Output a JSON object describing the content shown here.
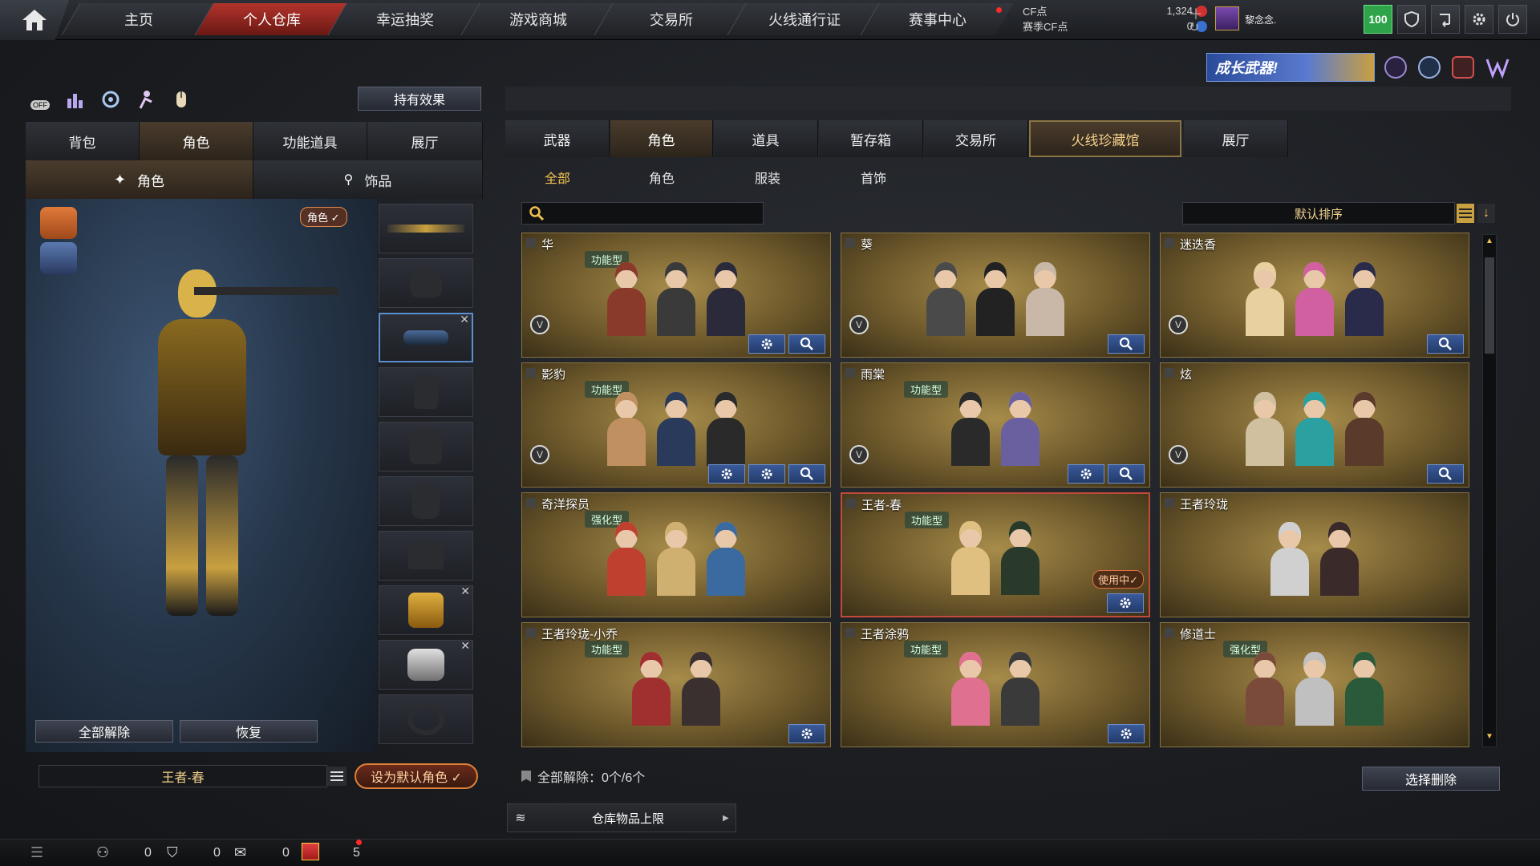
{
  "nav": {
    "tabs": [
      "主页",
      "个人仓库",
      "幸运抽奖",
      "游戏商城",
      "交易所",
      "火线通行证",
      "赛事中心"
    ],
    "active_tab": "个人仓库"
  },
  "currency": {
    "cf_label": "CF点",
    "cf_value": "1,324",
    "season_label": "赛季CF点",
    "season_value": "0"
  },
  "user": {
    "name": "黎念念.",
    "level": "100"
  },
  "banner": {
    "text": "成长武器!"
  },
  "left": {
    "effect_button": "持有效果",
    "tabs": [
      "背包",
      "角色",
      "功能道具",
      "展厅"
    ],
    "active_tab": "角色",
    "subtabs": [
      "角色",
      "饰品"
    ],
    "badge": "角色 ✓",
    "release_all": "全部解除",
    "restore": "恢复",
    "current_role": "王者-春",
    "set_default": "设为默认角色 ✓"
  },
  "right": {
    "tabs": [
      "武器",
      "角色",
      "道具",
      "暂存箱",
      "交易所",
      "火线珍藏馆",
      "展厅"
    ],
    "active_tabs": [
      "角色",
      "火线珍藏馆"
    ],
    "subtabs": [
      "全部",
      "角色",
      "服装",
      "首饰"
    ],
    "active_subtab": "全部",
    "search_placeholder": "",
    "sort_label": "默认排序",
    "footer_release": "全部解除：0个/6个",
    "select_delete": "选择删除",
    "storage_limit": "仓库物品上限"
  },
  "cards": [
    {
      "name": "华",
      "badge": "功能型",
      "v": true,
      "buttons": [
        "gear",
        "search"
      ],
      "colors": [
        "#8a3a2a",
        "#3a3a3a",
        "#2a2a3a"
      ]
    },
    {
      "name": "葵",
      "badge": "",
      "v": true,
      "buttons": [
        "search"
      ],
      "colors": [
        "#4a4a4a",
        "#222",
        "#c9b8a8"
      ]
    },
    {
      "name": "迷迭香",
      "badge": "",
      "v": true,
      "buttons": [
        "search"
      ],
      "colors": [
        "#e8d0a0",
        "#d060a0",
        "#2a2a4a"
      ]
    },
    {
      "name": "影豹",
      "badge": "功能型",
      "v": true,
      "buttons": [
        "gear-w",
        "gear",
        "search"
      ],
      "colors": [
        "#c09060",
        "#2a3a5a",
        "#2a2a2a"
      ]
    },
    {
      "name": "雨棠",
      "badge": "功能型",
      "v": true,
      "buttons": [
        "gear-w",
        "search"
      ],
      "colors": [
        "#2a2a2a",
        "#6a60a0"
      ]
    },
    {
      "name": "炫",
      "badge": "",
      "v": true,
      "buttons": [
        "search"
      ],
      "colors": [
        "#d0c0a0",
        "#2aa0a0",
        "#5a3a2a"
      ]
    },
    {
      "name": "奇洋探员",
      "badge": "强化型",
      "v": false,
      "buttons": [],
      "colors": [
        "#c04030",
        "#d0b070",
        "#3a6aa0"
      ]
    },
    {
      "name": "王者-春",
      "badge": "功能型",
      "v": false,
      "buttons": [
        "gear"
      ],
      "colors": [
        "#e0c080",
        "#2a3a2a"
      ],
      "in_use": "使用中✓"
    },
    {
      "name": "王者玲珑",
      "badge": "",
      "v": false,
      "buttons": [],
      "colors": [
        "#d0d0d0",
        "#3a2a2a"
      ]
    },
    {
      "name": "王者玲珑-小乔",
      "badge": "功能型",
      "v": false,
      "buttons": [
        "gear"
      ],
      "colors": [
        "#a03030",
        "#3a3030"
      ]
    },
    {
      "name": "王者涂鸦",
      "badge": "功能型",
      "v": false,
      "buttons": [
        "gear"
      ],
      "colors": [
        "#e07090",
        "#3a3a3a"
      ]
    },
    {
      "name": "修道士",
      "badge": "强化型",
      "v": false,
      "buttons": [],
      "colors": [
        "#7a4a3a",
        "#c0c0c0",
        "#2a5a3a"
      ]
    }
  ],
  "bottom": {
    "count1": "0",
    "count2": "0",
    "count3": "0",
    "count4": "5"
  }
}
